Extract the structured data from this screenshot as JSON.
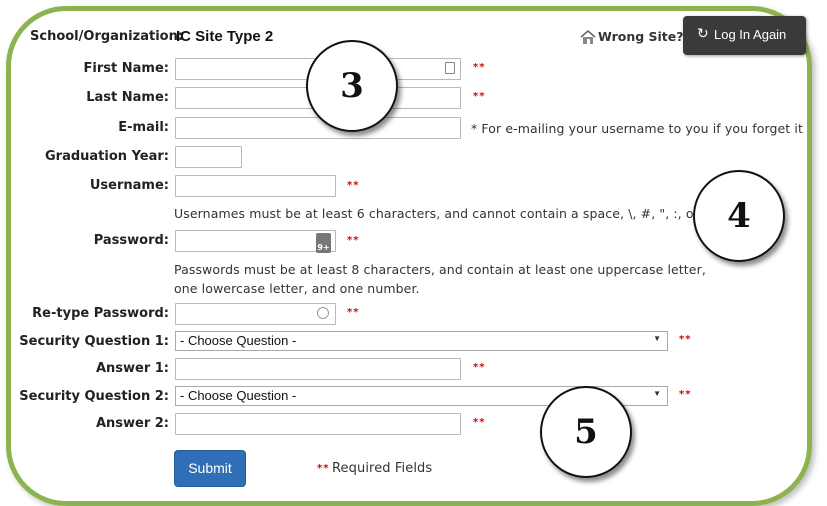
{
  "header": {
    "school_label": "School/Organization:",
    "school_value": "IC Site Type 2",
    "wrong_site": "Wrong Site?",
    "login_again": "Log In Again"
  },
  "form": {
    "first_name": {
      "label": "First Name:",
      "required": "**"
    },
    "last_name": {
      "label": "Last Name:",
      "required": "**"
    },
    "email": {
      "label": "E-mail:",
      "note": "* For e-mailing your username to you if you forget it"
    },
    "graduation_year": {
      "label": "Graduation Year:"
    },
    "username": {
      "label": "Username:",
      "required": "**",
      "help": "Usernames must be at least 6 characters, and cannot contain a space, \\, #, \", :, or"
    },
    "password": {
      "label": "Password:",
      "required": "**",
      "badge": "9+",
      "help_line1": "Passwords must be at least 8 characters, and contain at least one uppercase letter,",
      "help_line2": "one lowercase letter, and one number."
    },
    "retype_password": {
      "label": "Re-type Password:",
      "required": "**"
    },
    "security_question_1": {
      "label": "Security Question 1:",
      "selected": "- Choose Question -",
      "required": "**"
    },
    "answer_1": {
      "label": "Answer 1:",
      "required": "**"
    },
    "security_question_2": {
      "label": "Security Question 2:",
      "selected": "- Choose Question -",
      "required": "**"
    },
    "answer_2": {
      "label": "Answer 2:",
      "required": "**"
    },
    "submit_label": "Submit",
    "required_legend_marker": "**",
    "required_legend_text": "Required Fields"
  },
  "callouts": [
    "3",
    "4",
    "5"
  ],
  "colors": {
    "frame": "#8db34f",
    "login_button_bg": "#3a3a3a",
    "submit_bg": "#2f6fb5",
    "required": "#dd0000"
  }
}
